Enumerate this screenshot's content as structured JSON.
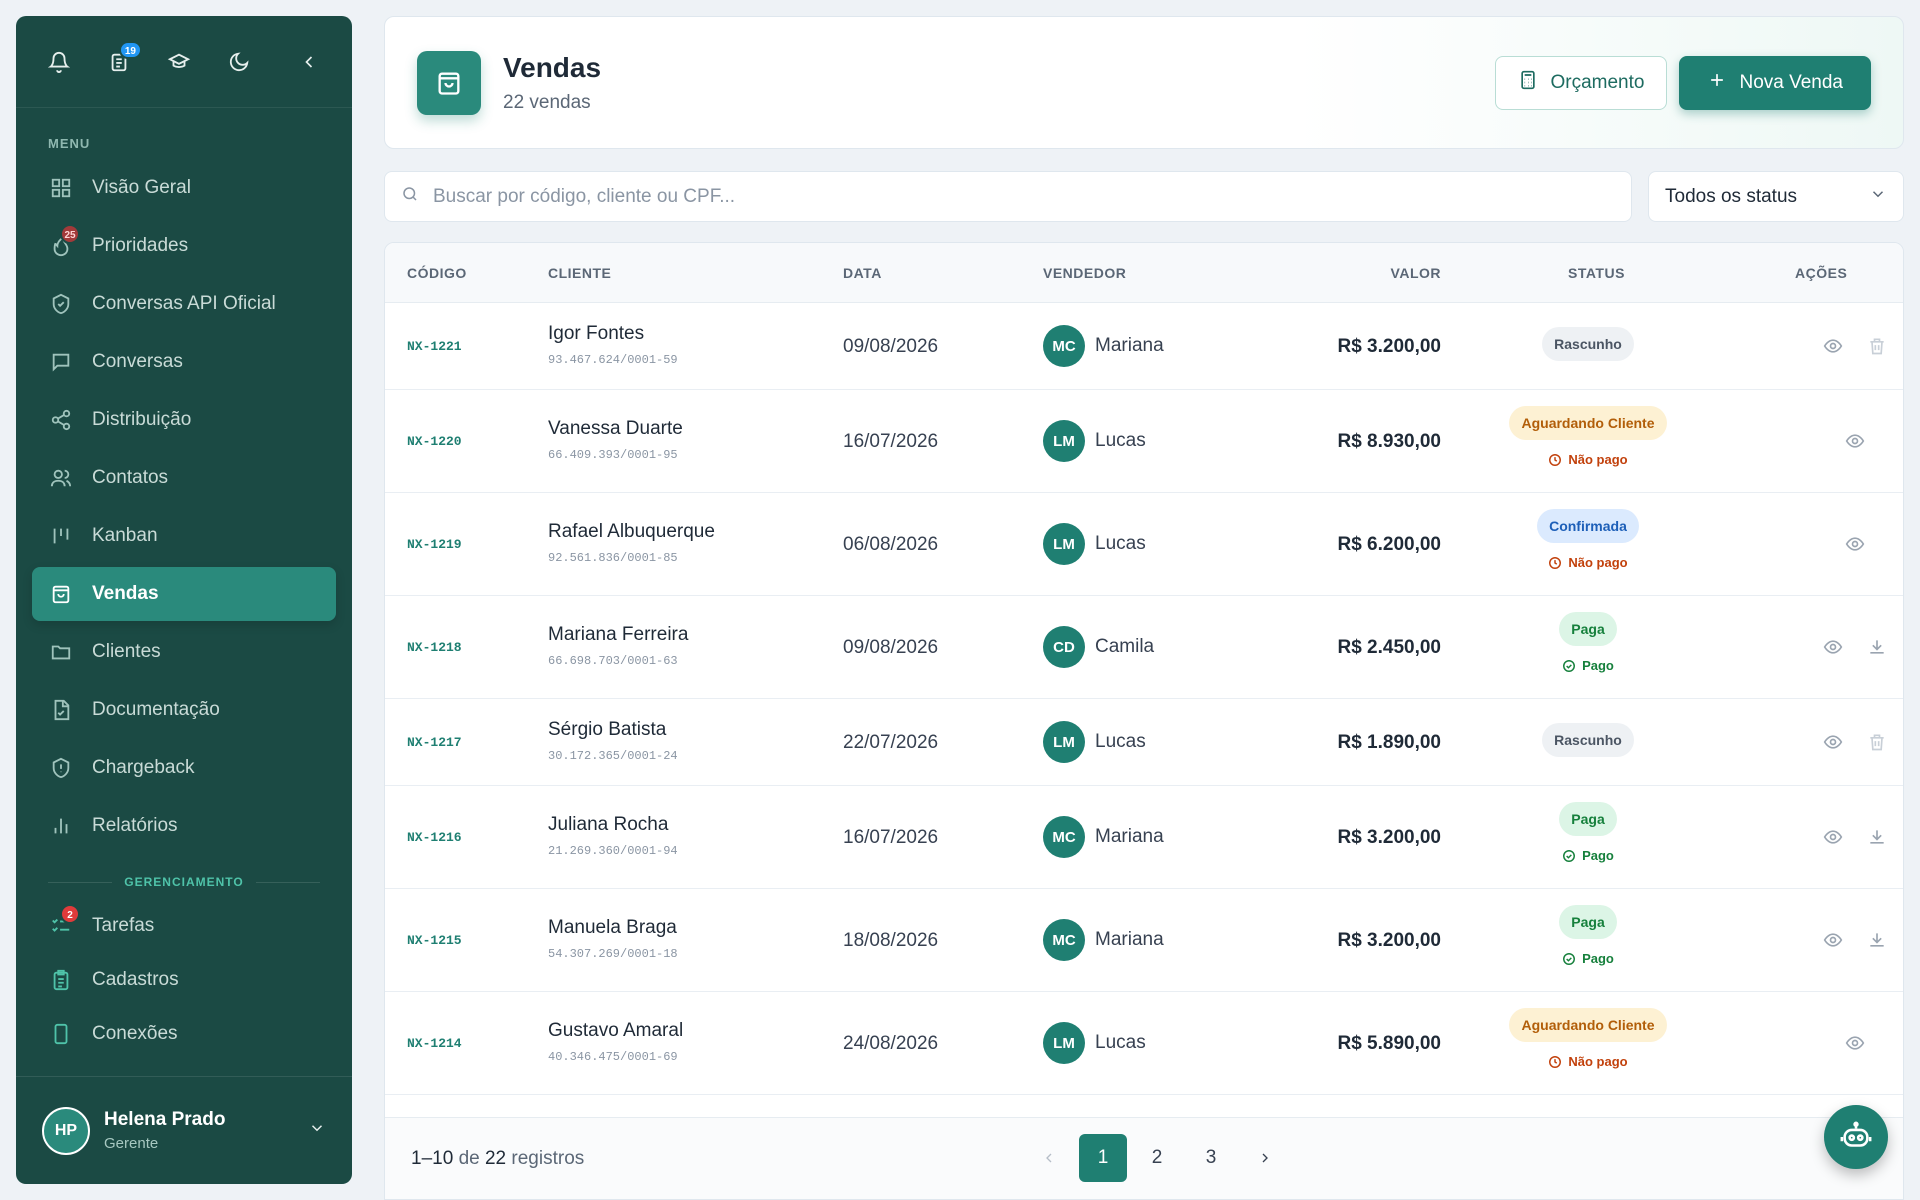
{
  "sidebar": {
    "top_badge": "19",
    "section_menu": "MENU",
    "items": [
      {
        "label": "Visão Geral"
      },
      {
        "label": "Prioridades",
        "badge": "25"
      },
      {
        "label": "Conversas API Oficial"
      },
      {
        "label": "Conversas"
      },
      {
        "label": "Distribuição"
      },
      {
        "label": "Contatos"
      },
      {
        "label": "Kanban"
      },
      {
        "label": "Vendas"
      },
      {
        "label": "Clientes"
      },
      {
        "label": "Documentação"
      },
      {
        "label": "Chargeback"
      },
      {
        "label": "Relatórios"
      }
    ],
    "section_management": "GERENCIAMENTO",
    "management_items": [
      {
        "label": "Tarefas",
        "badge": "2"
      },
      {
        "label": "Cadastros"
      },
      {
        "label": "Conexões"
      }
    ],
    "user": {
      "initials": "HP",
      "name": "Helena Prado",
      "role": "Gerente"
    }
  },
  "header": {
    "title": "Vendas",
    "subtitle": "22 vendas",
    "quote_label": "Orçamento",
    "new_sale_label": "Nova Venda"
  },
  "search": {
    "placeholder": "Buscar por código, cliente ou CPF..."
  },
  "status_filter": {
    "selected": "Todos os status"
  },
  "table": {
    "columns": {
      "code": "CÓDIGO",
      "client": "CLIENTE",
      "date": "DATA",
      "seller": "VENDEDOR",
      "value": "VALOR",
      "status": "STATUS",
      "actions": "AÇÕES"
    },
    "rows": [
      {
        "code": "NX-1221",
        "client": "Igor Fontes",
        "doc": "93.467.624/0001-59",
        "date": "09/08/2026",
        "seller_initials": "MC",
        "seller": "Mariana",
        "value": "R$ 3.200,00",
        "status": "Rascunho",
        "payment": ""
      },
      {
        "code": "NX-1220",
        "client": "Vanessa Duarte",
        "doc": "66.409.393/0001-95",
        "date": "16/07/2026",
        "seller_initials": "LM",
        "seller": "Lucas",
        "value": "R$ 8.930,00",
        "status": "Aguardando Cliente",
        "payment": "Não pago"
      },
      {
        "code": "NX-1219",
        "client": "Rafael Albuquerque",
        "doc": "92.561.836/0001-85",
        "date": "06/08/2026",
        "seller_initials": "LM",
        "seller": "Lucas",
        "value": "R$ 6.200,00",
        "status": "Confirmada",
        "payment": "Não pago"
      },
      {
        "code": "NX-1218",
        "client": "Mariana Ferreira",
        "doc": "66.698.703/0001-63",
        "date": "09/08/2026",
        "seller_initials": "CD",
        "seller": "Camila",
        "value": "R$ 2.450,00",
        "status": "Paga",
        "payment": "Pago"
      },
      {
        "code": "NX-1217",
        "client": "Sérgio Batista",
        "doc": "30.172.365/0001-24",
        "date": "22/07/2026",
        "seller_initials": "LM",
        "seller": "Lucas",
        "value": "R$ 1.890,00",
        "status": "Rascunho",
        "payment": ""
      },
      {
        "code": "NX-1216",
        "client": "Juliana Rocha",
        "doc": "21.269.360/0001-94",
        "date": "16/07/2026",
        "seller_initials": "MC",
        "seller": "Mariana",
        "value": "R$ 3.200,00",
        "status": "Paga",
        "payment": "Pago"
      },
      {
        "code": "NX-1215",
        "client": "Manuela Braga",
        "doc": "54.307.269/0001-18",
        "date": "18/08/2026",
        "seller_initials": "MC",
        "seller": "Mariana",
        "value": "R$ 3.200,00",
        "status": "Paga",
        "payment": "Pago"
      },
      {
        "code": "NX-1214",
        "client": "Gustavo Amaral",
        "doc": "40.346.475/0001-69",
        "date": "24/08/2026",
        "seller_initials": "LM",
        "seller": "Lucas",
        "value": "R$ 5.890,00",
        "status": "Aguardando Cliente",
        "payment": "Não pago"
      }
    ]
  },
  "pagination": {
    "range": "1–10",
    "of": "de",
    "total": "22",
    "suffix": "registros",
    "pages": [
      "1",
      "2",
      "3"
    ]
  },
  "colors": {
    "sidebar": "#1b4a44",
    "accent": "#1f7f72",
    "active": "#2a8a7c"
  }
}
